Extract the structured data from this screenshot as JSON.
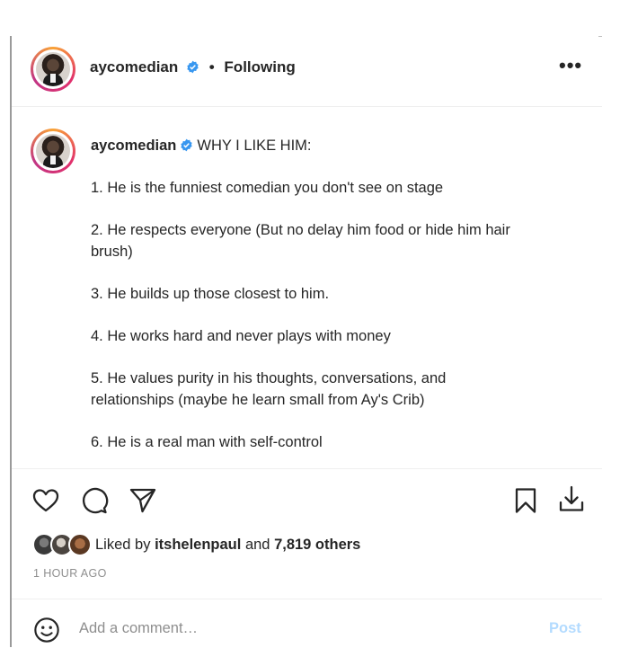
{
  "post": {
    "author": "aycomedian",
    "separator": "•",
    "follow_status": "Following",
    "more_label": "•••"
  },
  "caption": {
    "author": "aycomedian",
    "headline": "WHY I LIKE HIM:",
    "points": [
      "1. He is the funniest comedian you don't see on stage",
      "2. He respects everyone (But no delay him food or hide him hair",
      "brush)",
      "3. He builds up those closest to him.",
      "4. He works hard and never plays with money",
      "5. He values purity in his thoughts, conversations, and",
      "relationships (maybe he learn small from Ay's Crib)",
      "6. He is a real man with self-control"
    ]
  },
  "likes": {
    "prefix": "Liked by",
    "top_liker": "itshelenpaul",
    "conjunction": "and",
    "others": "7,819 others"
  },
  "timestamp": "1 HOUR AGO",
  "comment": {
    "placeholder": "Add a comment…",
    "post_label": "Post"
  },
  "icons": [
    "more-options-icon",
    "verified-badge-icon",
    "heart-icon",
    "comment-icon",
    "share-icon",
    "bookmark-icon",
    "download-icon",
    "emoji-icon"
  ],
  "colors": {
    "verified": "#3897f0",
    "post_button_disabled": "#b3dbff",
    "muted_text": "#8e8e8e"
  }
}
